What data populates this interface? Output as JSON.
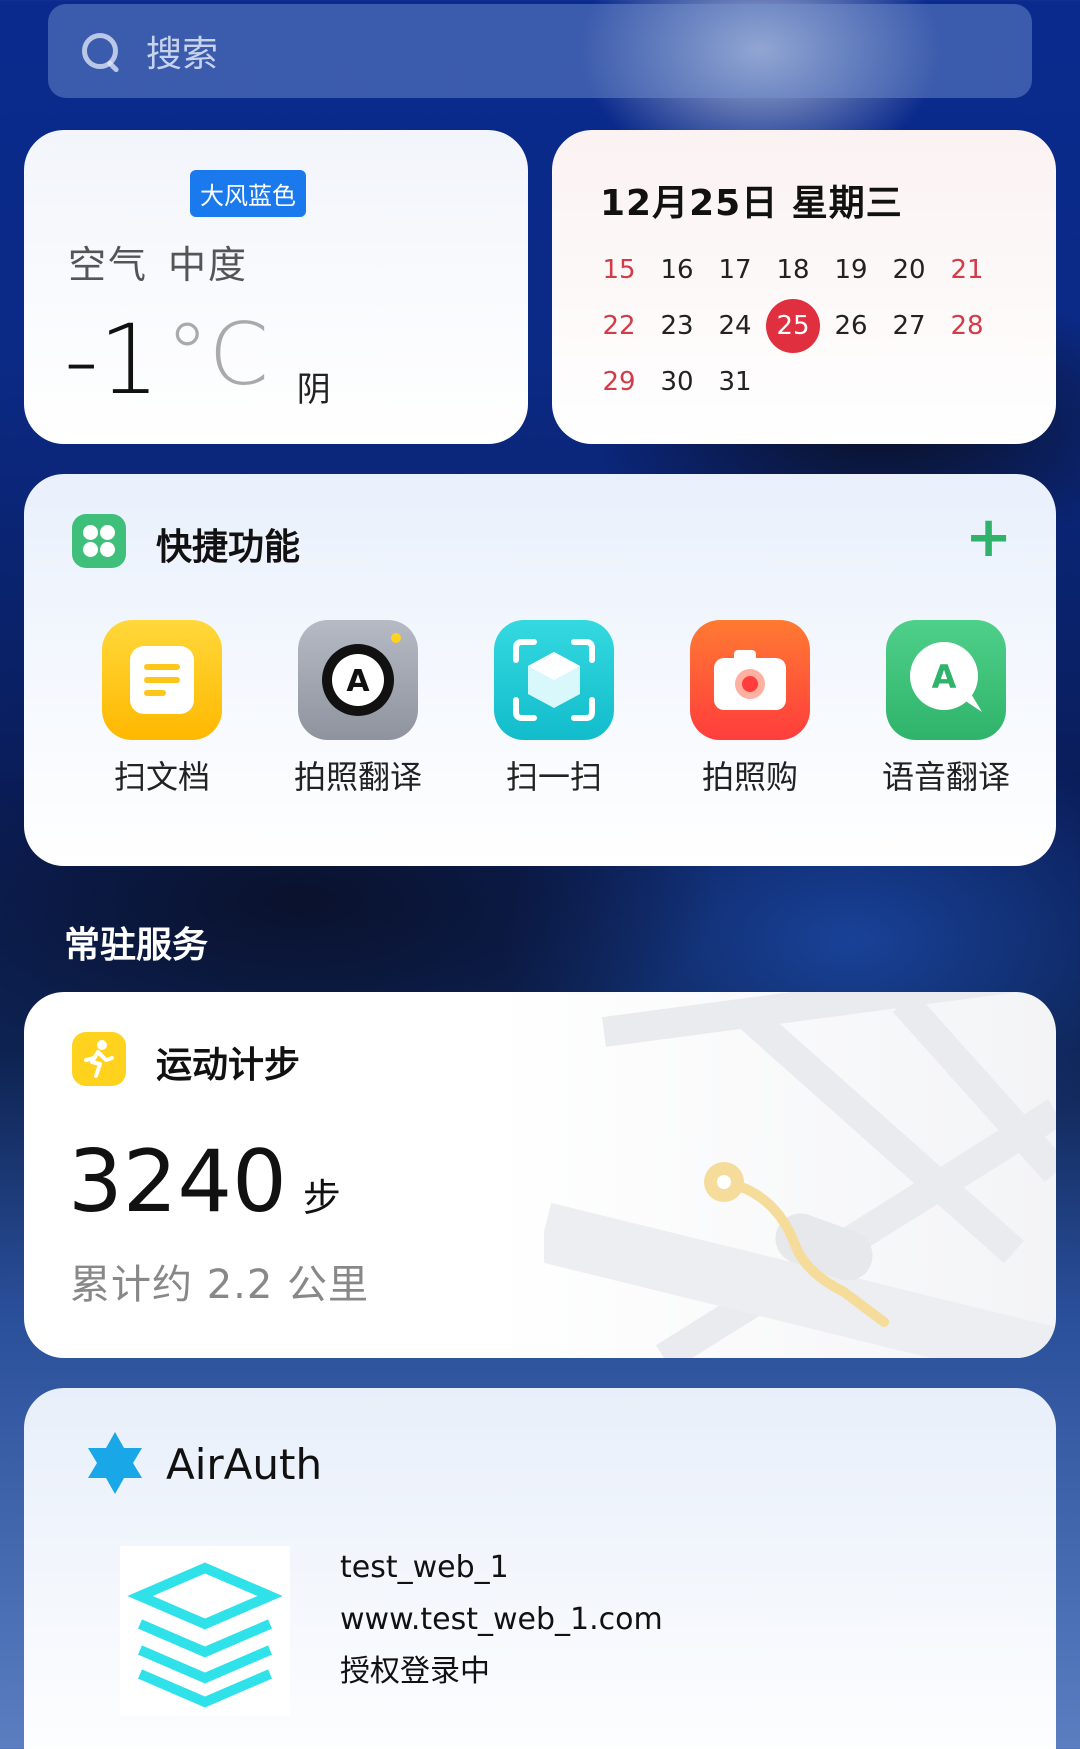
{
  "search": {
    "placeholder": "搜索"
  },
  "weather": {
    "badge": "大风蓝色",
    "air_label": "空气",
    "air_value": "中度",
    "temperature": "-1",
    "unit": "°C",
    "condition": "阴"
  },
  "calendar": {
    "date": "12月25日 星期三",
    "rows": [
      [
        "15",
        "16",
        "17",
        "18",
        "19",
        "20",
        "21"
      ],
      [
        "22",
        "23",
        "24",
        "25",
        "26",
        "27",
        "28"
      ],
      [
        "29",
        "30",
        "31"
      ]
    ],
    "today": "25",
    "accent": "#e02f3e"
  },
  "quick": {
    "title": "快捷功能",
    "add": "+",
    "apps": [
      {
        "label": "扫文档",
        "icon": "document-scan-icon",
        "color": "#ffc61a"
      },
      {
        "label": "拍照翻译",
        "icon": "photo-translate-icon",
        "color": "#9ea3ae"
      },
      {
        "label": "扫一扫",
        "icon": "scan-cube-icon",
        "color": "#1ecbd6"
      },
      {
        "label": "拍照购",
        "icon": "camera-shop-icon",
        "color": "#ff5a36"
      },
      {
        "label": "语音翻译",
        "icon": "voice-translate-icon",
        "color": "#3ec07b"
      }
    ]
  },
  "services": {
    "title": "常驻服务"
  },
  "steps": {
    "title": "运动计步",
    "count": "3240",
    "unit": "步",
    "distance": "累计约 2.2 公里"
  },
  "airauth": {
    "title": "AirAuth",
    "site_name": "test_web_1",
    "url": "www.test_web_1.com",
    "status": "授权登录中",
    "brand_color": "#1aa7e8"
  }
}
